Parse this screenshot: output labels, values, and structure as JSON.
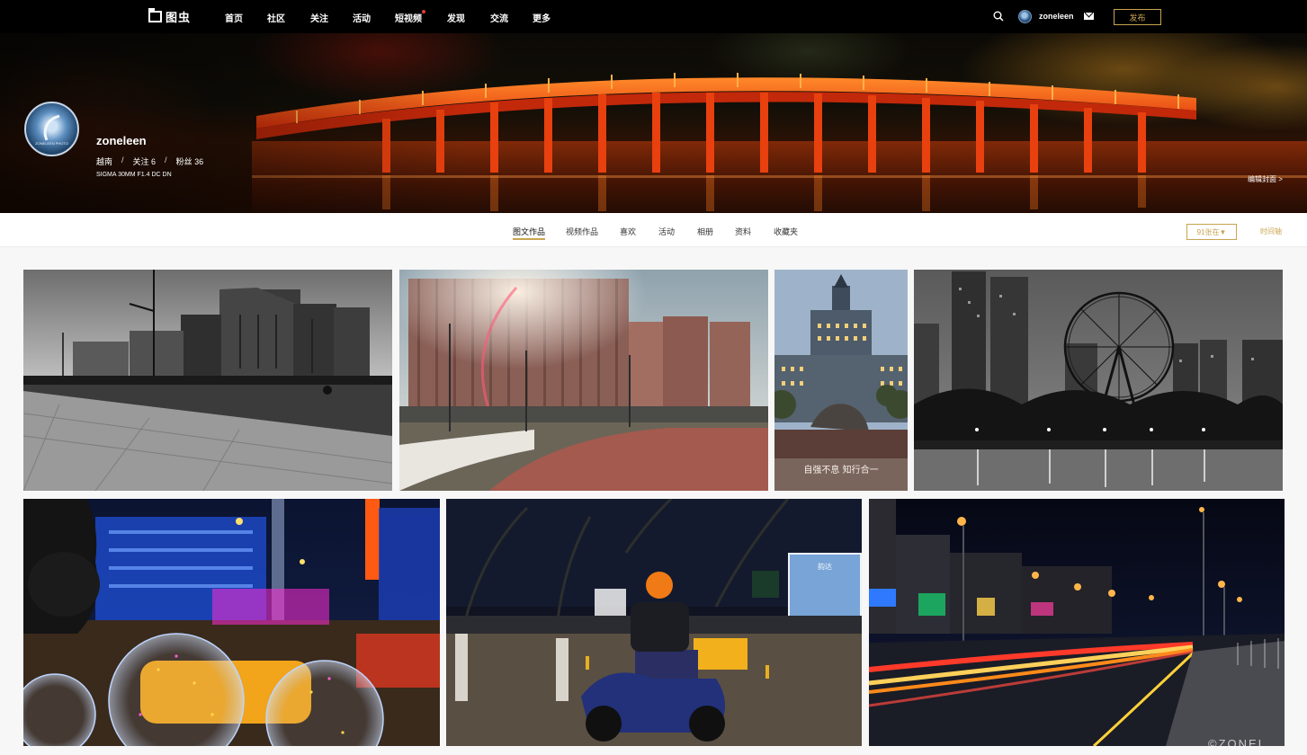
{
  "nav": {
    "logo_text": "图虫",
    "items": [
      "首页",
      "社区",
      "关注",
      "活动",
      "短视频",
      "发现",
      "交流",
      "更多"
    ],
    "user_name": "zoneleen",
    "publish_label": "发布"
  },
  "profile": {
    "name": "zoneleen",
    "location": "越南",
    "following": "关注 6",
    "fans": "粉丝 36",
    "gear": "SIGMA 30MM F1.4 DC DN",
    "avatar_caption": "ZONELEEN PHOTO",
    "edit_cover": "编辑封面 >"
  },
  "tabs": [
    "图文作品",
    "视频作品",
    "喜欢",
    "活动",
    "相册",
    "资料",
    "收藏夹"
  ],
  "active_tab": "图文作品",
  "sort_label": "91张在▼",
  "timeline_label": "时间轴",
  "gallery": [
    {
      "name": "bw-modern-buildings"
    },
    {
      "name": "university-building-sunflare"
    },
    {
      "name": "tower-building-stone"
    },
    {
      "name": "ferris-wheel-night-bw"
    },
    {
      "name": "neon-bubble-balloons"
    },
    {
      "name": "delivery-rider-night"
    },
    {
      "name": "light-trails-street"
    }
  ],
  "stone_text": "自强不息 知行合一",
  "truck_text": "韵达",
  "watermark": "©ZONEL",
  "colors": {
    "accent": "#c9a452",
    "nav_bg": "#000000",
    "bridge": "#ff4a12"
  },
  "icons": {
    "search": "search-icon",
    "mail": "mail-icon",
    "avatar": "avatar"
  }
}
